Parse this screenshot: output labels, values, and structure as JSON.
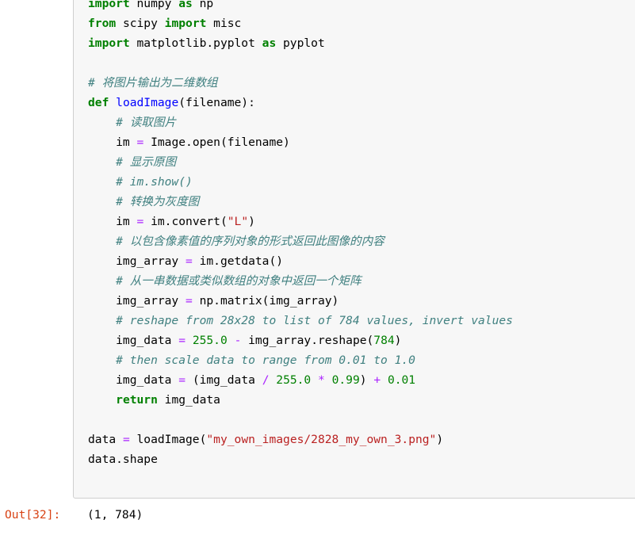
{
  "notebook": {
    "colors": {
      "cell_background": "#f7f7f7",
      "cell_border": "#cfcfcf",
      "page_background": "#ffffff",
      "keyword": "#008000",
      "function_name": "#0000ff",
      "comment": "#408080",
      "string": "#ba2121",
      "number": "#008000",
      "operator": "#aa22ff",
      "out_prompt": "#d84315",
      "plain_text": "#000000"
    },
    "input_cell": {
      "language": "python",
      "lines": [
        {
          "id": "line-0-clipped",
          "tokens": [
            {
              "t": "import",
              "c": "kw"
            },
            {
              "t": " ",
              "c": "nm"
            },
            {
              "t": "numpy",
              "c": "nm"
            },
            {
              "t": " ",
              "c": "nm"
            },
            {
              "t": "as",
              "c": "kw"
            },
            {
              "t": " ",
              "c": "nm"
            },
            {
              "t": "np",
              "c": "nm"
            }
          ]
        },
        {
          "id": "line-1",
          "tokens": [
            {
              "t": "from",
              "c": "kw"
            },
            {
              "t": " scipy ",
              "c": "nm"
            },
            {
              "t": "import",
              "c": "kw"
            },
            {
              "t": " misc",
              "c": "nm"
            }
          ]
        },
        {
          "id": "line-2",
          "tokens": [
            {
              "t": "import",
              "c": "kw"
            },
            {
              "t": " matplotlib.pyplot ",
              "c": "nm"
            },
            {
              "t": "as",
              "c": "kw"
            },
            {
              "t": " pyplot",
              "c": "nm"
            }
          ]
        },
        {
          "id": "line-3-blank",
          "tokens": [
            {
              "t": "",
              "c": "nm"
            }
          ]
        },
        {
          "id": "line-4",
          "tokens": [
            {
              "t": "# 将图片输出为二维数组",
              "c": "cm"
            }
          ]
        },
        {
          "id": "line-5",
          "tokens": [
            {
              "t": "def",
              "c": "kw"
            },
            {
              "t": " ",
              "c": "nm"
            },
            {
              "t": "loadImage",
              "c": "fn"
            },
            {
              "t": "(filename):",
              "c": "nm"
            }
          ]
        },
        {
          "id": "line-6",
          "tokens": [
            {
              "t": "    # 读取图片",
              "c": "cm"
            }
          ]
        },
        {
          "id": "line-7",
          "tokens": [
            {
              "t": "    im ",
              "c": "nm"
            },
            {
              "t": "=",
              "c": "op"
            },
            {
              "t": " Image.open(filename)",
              "c": "nm"
            }
          ]
        },
        {
          "id": "line-8",
          "tokens": [
            {
              "t": "    # 显示原图",
              "c": "cm"
            }
          ]
        },
        {
          "id": "line-9",
          "tokens": [
            {
              "t": "    # im.show()",
              "c": "cm"
            }
          ]
        },
        {
          "id": "line-10",
          "tokens": [
            {
              "t": "    # 转换为灰度图",
              "c": "cm"
            }
          ]
        },
        {
          "id": "line-11",
          "tokens": [
            {
              "t": "    im ",
              "c": "nm"
            },
            {
              "t": "=",
              "c": "op"
            },
            {
              "t": " im.convert(",
              "c": "nm"
            },
            {
              "t": "\"L\"",
              "c": "st"
            },
            {
              "t": ")",
              "c": "nm"
            }
          ]
        },
        {
          "id": "line-12",
          "tokens": [
            {
              "t": "    # 以包含像素值的序列对象的形式返回此图像的内容",
              "c": "cm"
            }
          ]
        },
        {
          "id": "line-13",
          "tokens": [
            {
              "t": "    img_array ",
              "c": "nm"
            },
            {
              "t": "=",
              "c": "op"
            },
            {
              "t": " im.getdata()",
              "c": "nm"
            }
          ]
        },
        {
          "id": "line-14",
          "tokens": [
            {
              "t": "    # 从一串数据或类似数组的对象中返回一个矩阵",
              "c": "cm"
            }
          ]
        },
        {
          "id": "line-15",
          "tokens": [
            {
              "t": "    img_array ",
              "c": "nm"
            },
            {
              "t": "=",
              "c": "op"
            },
            {
              "t": " np.matrix(img_array)",
              "c": "nm"
            }
          ]
        },
        {
          "id": "line-16",
          "tokens": [
            {
              "t": "    # reshape from 28x28 to list of 784 values, invert values",
              "c": "cm"
            }
          ]
        },
        {
          "id": "line-17",
          "tokens": [
            {
              "t": "    img_data ",
              "c": "nm"
            },
            {
              "t": "=",
              "c": "op"
            },
            {
              "t": " ",
              "c": "nm"
            },
            {
              "t": "255.0",
              "c": "nu"
            },
            {
              "t": " ",
              "c": "nm"
            },
            {
              "t": "-",
              "c": "op"
            },
            {
              "t": " img_array.reshape(",
              "c": "nm"
            },
            {
              "t": "784",
              "c": "nu"
            },
            {
              "t": ")",
              "c": "nm"
            }
          ]
        },
        {
          "id": "line-18",
          "tokens": [
            {
              "t": "    # then scale data to range from 0.01 to 1.0",
              "c": "cm"
            }
          ]
        },
        {
          "id": "line-19",
          "tokens": [
            {
              "t": "    img_data ",
              "c": "nm"
            },
            {
              "t": "=",
              "c": "op"
            },
            {
              "t": " (img_data ",
              "c": "nm"
            },
            {
              "t": "/",
              "c": "op"
            },
            {
              "t": " ",
              "c": "nm"
            },
            {
              "t": "255.0",
              "c": "nu"
            },
            {
              "t": " ",
              "c": "nm"
            },
            {
              "t": "*",
              "c": "op"
            },
            {
              "t": " ",
              "c": "nm"
            },
            {
              "t": "0.99",
              "c": "nu"
            },
            {
              "t": ") ",
              "c": "nm"
            },
            {
              "t": "+",
              "c": "op"
            },
            {
              "t": " ",
              "c": "nm"
            },
            {
              "t": "0.01",
              "c": "nu"
            }
          ]
        },
        {
          "id": "line-20",
          "tokens": [
            {
              "t": "    ",
              "c": "nm"
            },
            {
              "t": "return",
              "c": "kw"
            },
            {
              "t": " img_data",
              "c": "nm"
            }
          ]
        },
        {
          "id": "line-21-blank",
          "tokens": [
            {
              "t": "",
              "c": "nm"
            }
          ]
        },
        {
          "id": "line-22",
          "tokens": [
            {
              "t": "data ",
              "c": "nm"
            },
            {
              "t": "=",
              "c": "op"
            },
            {
              "t": " loadImage(",
              "c": "nm"
            },
            {
              "t": "\"my_own_images/2828_my_own_3.png\"",
              "c": "st"
            },
            {
              "t": ")",
              "c": "nm"
            }
          ]
        },
        {
          "id": "line-23",
          "tokens": [
            {
              "t": "data.shape",
              "c": "nm"
            }
          ]
        }
      ]
    },
    "output_cell": {
      "prompt": "Out[32]:",
      "execution_count": 32,
      "text": "(1, 784)"
    }
  }
}
